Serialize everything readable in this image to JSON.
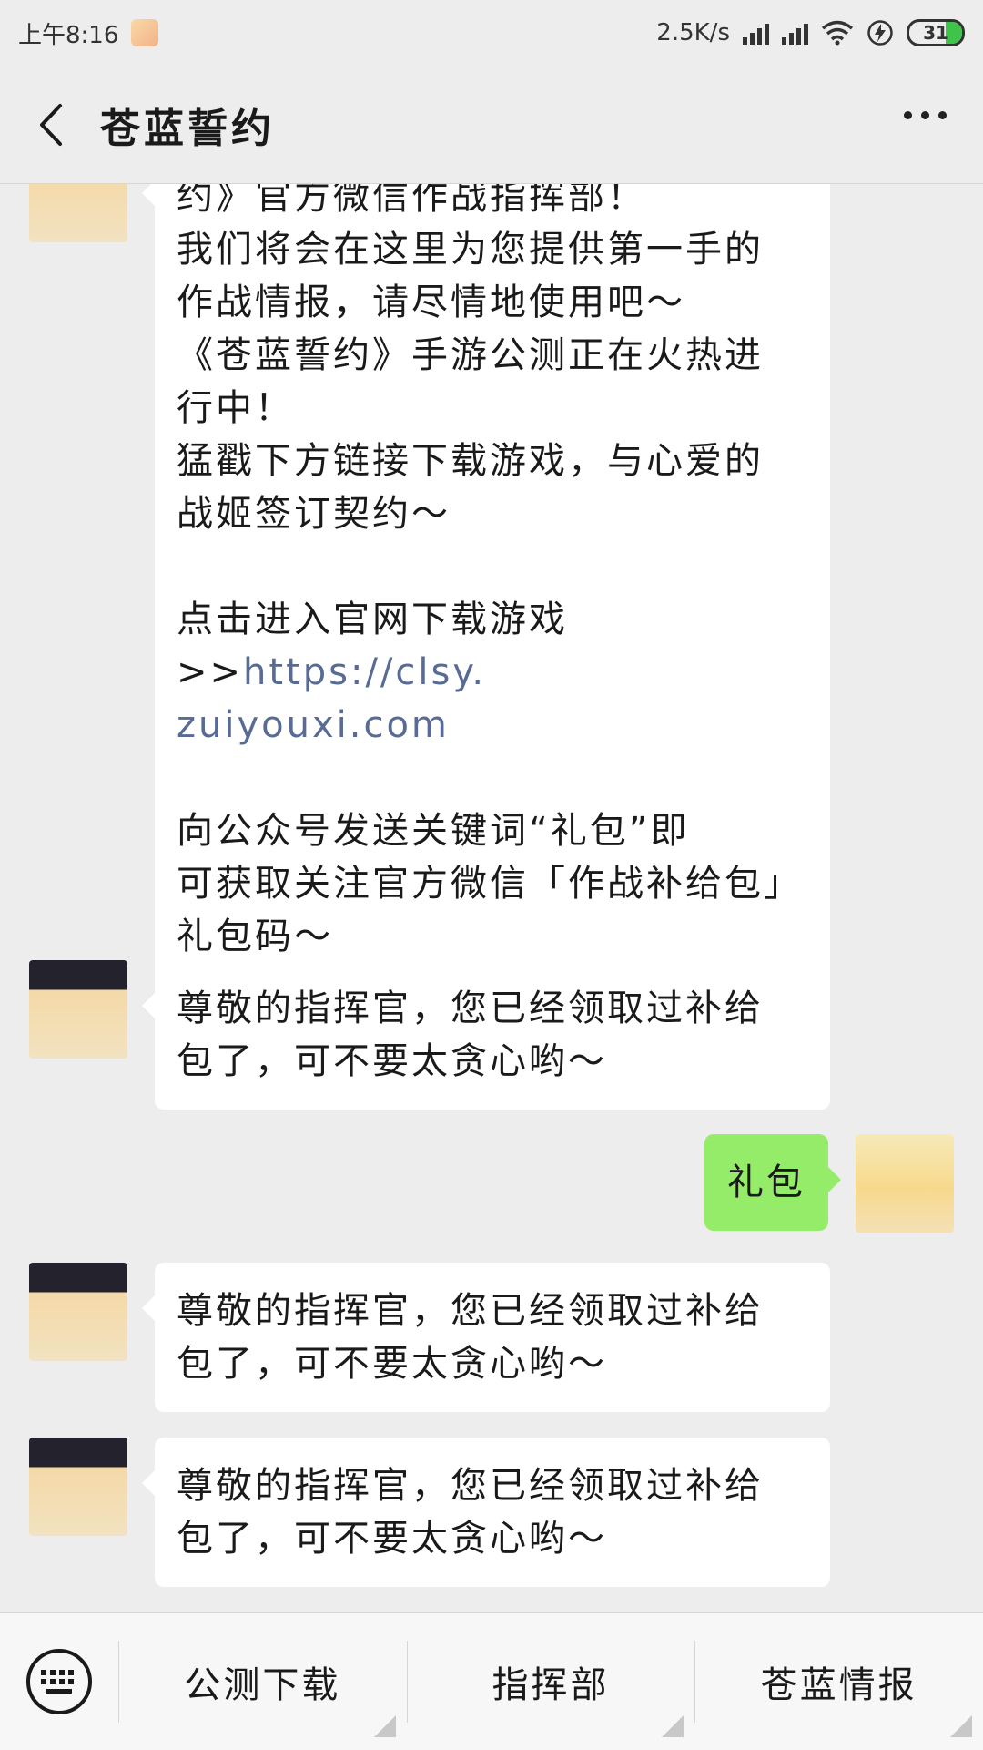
{
  "status_bar": {
    "time": "上午8:16",
    "speed": "2.5K/s",
    "battery": "31"
  },
  "nav": {
    "title": "苍蓝誓约"
  },
  "messages": {
    "first": {
      "lines": [
        "约》官方微信作战指挥部！",
        "我们将会在这里为您提供第一手的",
        "作战情报，请尽情地使用吧～",
        "《苍蓝誓约》手游公测正在火热进",
        "行中！",
        "猛戳下方链接下载游戏，与心爱的",
        "战姬签订契约～"
      ],
      "link_prefix": "点击进入官网下载游戏>>",
      "link_part1": "https://clsy.",
      "link_part2": "zuiyouxi.com",
      "gift_lines": [
        "向公众号发送关键词“礼包”即",
        "可获取关注官方微信「作战补给包」",
        "礼包码～"
      ]
    },
    "reply_line1": "尊敬的指挥官，您已经领取过补给",
    "reply_line2": "包了，可不要太贪心哟～",
    "user_msg": "礼包"
  },
  "menu": {
    "item1": "公测下载",
    "item2": "指挥部",
    "item3": "苍蓝情报"
  }
}
